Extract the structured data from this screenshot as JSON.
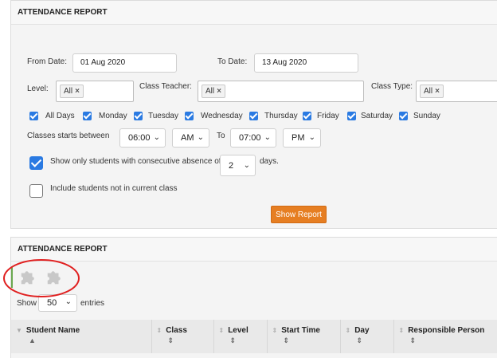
{
  "report_panel": {
    "title": "ATTENDANCE REPORT",
    "from_date_label": "From Date:",
    "from_date_value": "01 Aug 2020",
    "to_date_label": "To Date:",
    "to_date_value": "13 Aug 2020",
    "level_label": "Level:",
    "class_teacher_label": "Class Teacher:",
    "class_type_label": "Class Type:",
    "tag_all": "All",
    "tag_remove": "×",
    "days": [
      "All Days",
      "Monday",
      "Tuesday",
      "Wednesday",
      "Thursday",
      "Friday",
      "Saturday",
      "Sunday"
    ],
    "classes_start_label": "Classes  starts  between",
    "start_time": "06:00",
    "start_ampm": "AM",
    "to_label": "To",
    "end_time": "07:00",
    "end_ampm": "PM",
    "consecutive_label": "Show only students with consecutive absence of",
    "consecutive_value": "2",
    "days_suffix": "days.",
    "include_label": "Include students not in current class",
    "show_report_button": "Show Report"
  },
  "results_panel": {
    "title": "ATTENDANCE REPORT",
    "show_label": "Show",
    "entries_value": "50",
    "entries_label": "entries",
    "columns": [
      "Student Name",
      "Class",
      "Level",
      "Start Time",
      "Day",
      "Responsible Person"
    ]
  },
  "annotation": {
    "color": "#e02020"
  },
  "colors": {
    "accent": "#2a7ae2",
    "button": "#e67e22"
  },
  "icons": {
    "dropdown": "chevron-down-icon",
    "puzzle": "puzzle-piece-icon"
  }
}
